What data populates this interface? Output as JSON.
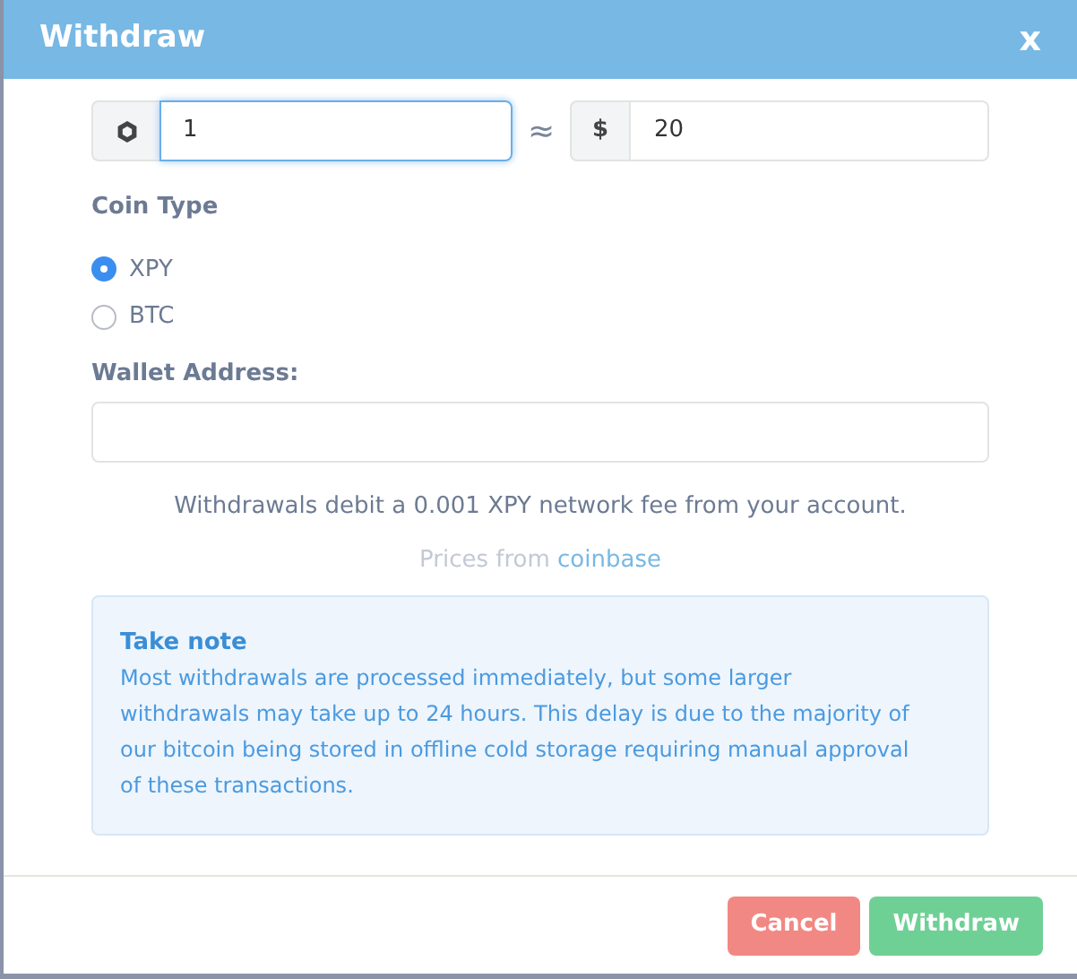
{
  "dialog": {
    "title": "Withdraw",
    "close": "x"
  },
  "amount": {
    "value": "1",
    "approx": "≈",
    "currency_symbol": "$",
    "usd_value": "20"
  },
  "coin_type": {
    "label": "Coin Type",
    "options": [
      {
        "label": "XPY",
        "selected": true
      },
      {
        "label": "BTC",
        "selected": false
      }
    ]
  },
  "wallet_address": {
    "label": "Wallet Address:"
  },
  "fee_text": "Withdrawals debit a 0.001 XPY network fee from your account.",
  "prices": {
    "text": "Prices from",
    "link": "coinbase"
  },
  "note": {
    "title": "Take note",
    "body": "Most withdrawals are processed immediately, but some larger withdrawals may take up to 24 hours. This delay is due to the majority of our bitcoin being stored in offline cold storage requiring manual approval of these transactions."
  },
  "buttons": [
    {
      "label": "Cancel",
      "kind": "cancel"
    },
    {
      "label": "Withdraw",
      "kind": "confirm"
    }
  ]
}
